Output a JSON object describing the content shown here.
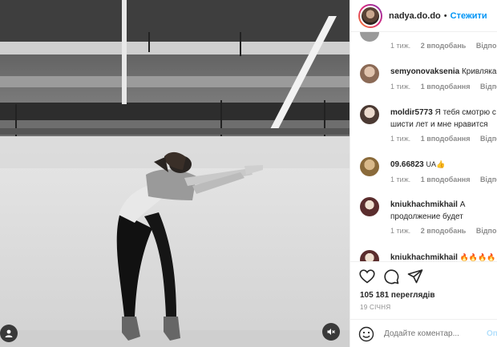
{
  "header": {
    "username": "nadya.do.do",
    "separator": "•",
    "follow_label": "Стежити"
  },
  "comments": [
    {
      "username": "",
      "text": "",
      "time": "1 тиж.",
      "replies": "2 вподобань",
      "reply_label": "Відповісти"
    },
    {
      "username": "semyonovaksenia",
      "text": "Кривляка",
      "time": "1 тиж.",
      "replies": "1 вподобання",
      "reply_label": "Відповісти"
    },
    {
      "username": "moldir5773",
      "text": "Я тебя смотрю с",
      "text2": "шисти лет и мне нравится",
      "time": "1 тиж.",
      "replies": "1 вподобання",
      "reply_label": "Відповісти"
    },
    {
      "username": "09.66823",
      "text": "UA👍",
      "time": "1 тиж.",
      "replies": "1 вподобання",
      "reply_label": "Відповісти"
    },
    {
      "username": "kniukhachmikhail",
      "text": "А",
      "text2": "продолжение будет",
      "time": "1 тиж.",
      "replies": "2 вподобань",
      "reply_label": "Відповісти"
    },
    {
      "username": "kniukhachmikhail",
      "text": "🔥🔥🔥🔥🔥"
    }
  ],
  "post": {
    "views": "105 181 переглядів",
    "date": "19 СІЧНЯ"
  },
  "add_comment": {
    "placeholder": "Додайте коментар...",
    "post_label": "Опублікувати"
  },
  "icons": {
    "like": "heart-icon",
    "comment": "comment-icon",
    "share": "share-icon",
    "emoji": "smiley-icon",
    "tagged_user": "user-icon",
    "sound": "sound-off-icon"
  },
  "colors": {
    "link": "#0095f6",
    "secondary_text": "#8e8e8e",
    "post_disabled": "#b2dffc"
  }
}
